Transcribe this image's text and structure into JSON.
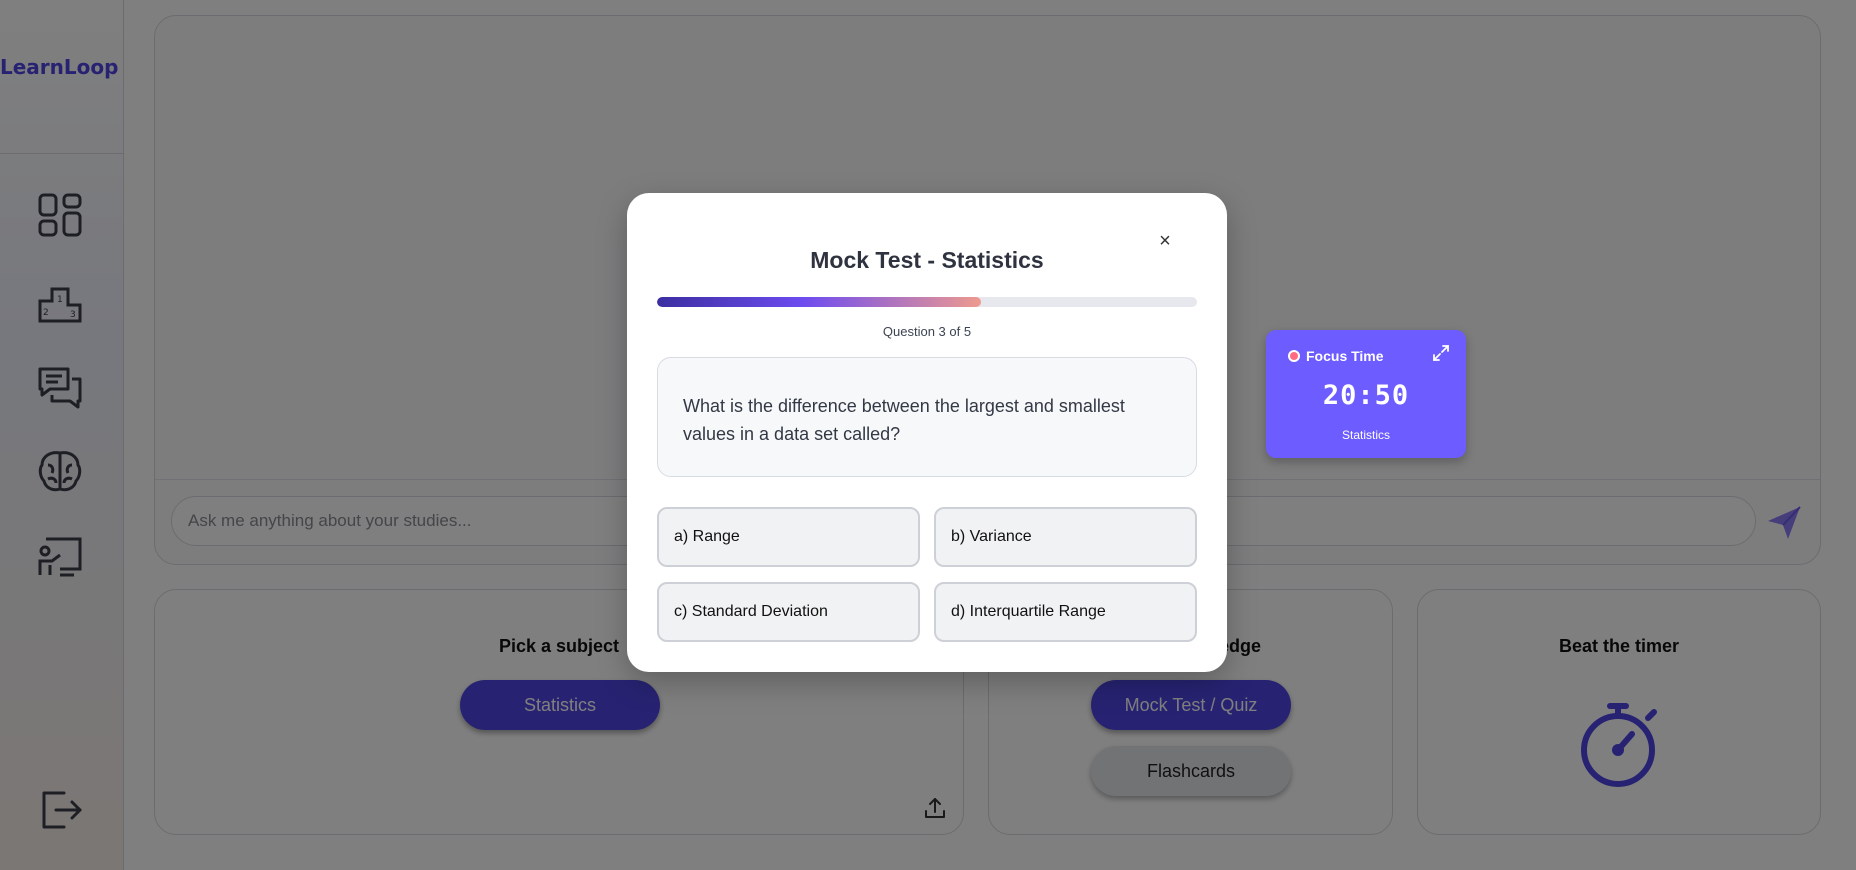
{
  "app": {
    "logo": "LearnLoop"
  },
  "sidebar": {
    "items": [
      {
        "name": "dashboard",
        "icon": "dashboard-grid-icon"
      },
      {
        "name": "leaderboard",
        "icon": "podium-icon"
      },
      {
        "name": "chat",
        "icon": "chat-bubbles-icon"
      },
      {
        "name": "brain",
        "icon": "brain-icon"
      },
      {
        "name": "classroom",
        "icon": "teacher-board-icon"
      }
    ],
    "logout_icon": "logout-icon"
  },
  "chat": {
    "placeholder": "Ask me anything about your studies...",
    "send_icon": "send-paper-plane-icon"
  },
  "cards": {
    "subject": {
      "title": "Pick a subject",
      "button": "Statistics",
      "upload_icon": "upload-icon"
    },
    "knowledge": {
      "title": "ledge",
      "primary_button": "Mock Test / Quiz",
      "secondary_button": "Flashcards"
    },
    "timer": {
      "title": "Beat the timer",
      "icon": "stopwatch-icon"
    }
  },
  "focus_widget": {
    "title": "Focus Time",
    "time": "20:50",
    "subject": "Statistics"
  },
  "modal": {
    "title": "Mock Test - Statistics",
    "close_label": "×",
    "progress_fraction": 0.6,
    "question_counter": "Question 3 of 5",
    "question": "What is the difference between the largest and smallest values in a data set called?",
    "options": [
      "a) Range",
      "b) Variance",
      "c) Standard Deviation",
      "d) Interquartile Range"
    ]
  },
  "colors": {
    "brand": "#4f46e5",
    "focus_widget_bg": "#6d5cff",
    "overlay": "rgba(0,0,0,0.5)"
  }
}
